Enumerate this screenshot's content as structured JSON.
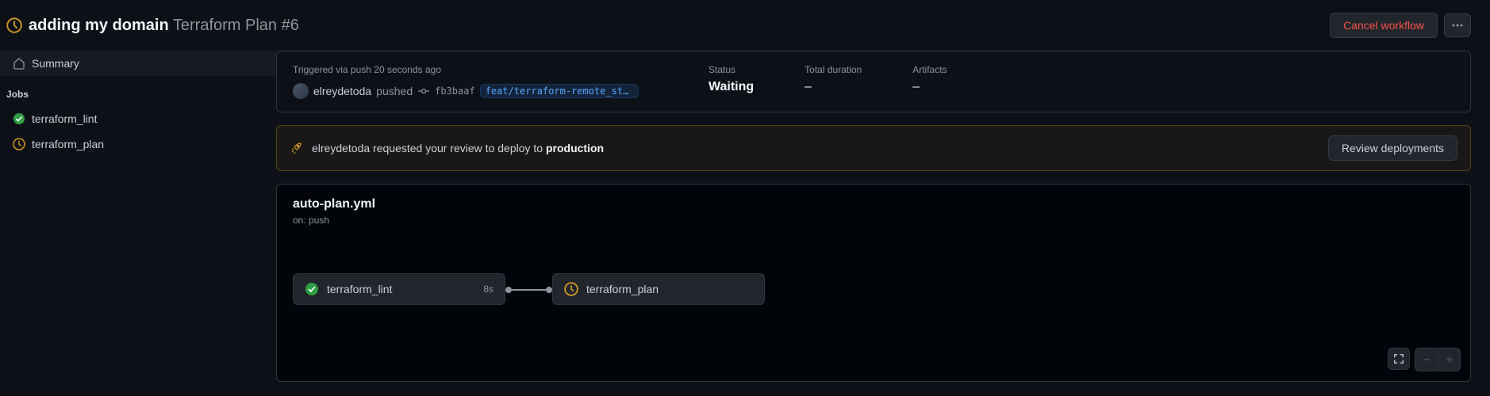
{
  "header": {
    "title_strong": "adding my domain",
    "title_rest": "Terraform Plan #6",
    "cancel_label": "Cancel workflow"
  },
  "sidebar": {
    "summary_label": "Summary",
    "jobs_heading": "Jobs",
    "jobs": [
      {
        "name": "terraform_lint",
        "status": "success"
      },
      {
        "name": "terraform_plan",
        "status": "waiting"
      }
    ]
  },
  "meta": {
    "trigger_text": "Triggered via push 20 seconds ago",
    "actor": "elreydetoda",
    "pushed_word": "pushed",
    "commit_sha": "fb3baaf",
    "branch": "feat/terraform-remote_sta…",
    "status_label": "Status",
    "status_value": "Waiting",
    "duration_label": "Total duration",
    "duration_value": "–",
    "artifacts_label": "Artifacts",
    "artifacts_value": "–"
  },
  "alert": {
    "prefix": "elreydetoda requested your review to deploy to ",
    "env": "production",
    "review_btn": "Review deployments"
  },
  "graph": {
    "workflow_file": "auto-plan.yml",
    "on_text": "on: push",
    "nodes": [
      {
        "name": "terraform_lint",
        "duration": "8s",
        "status": "success"
      },
      {
        "name": "terraform_plan",
        "duration": "",
        "status": "waiting"
      }
    ]
  },
  "colors": {
    "success": "#2ea043",
    "waiting": "#d29922",
    "bg": "#0d1117"
  }
}
